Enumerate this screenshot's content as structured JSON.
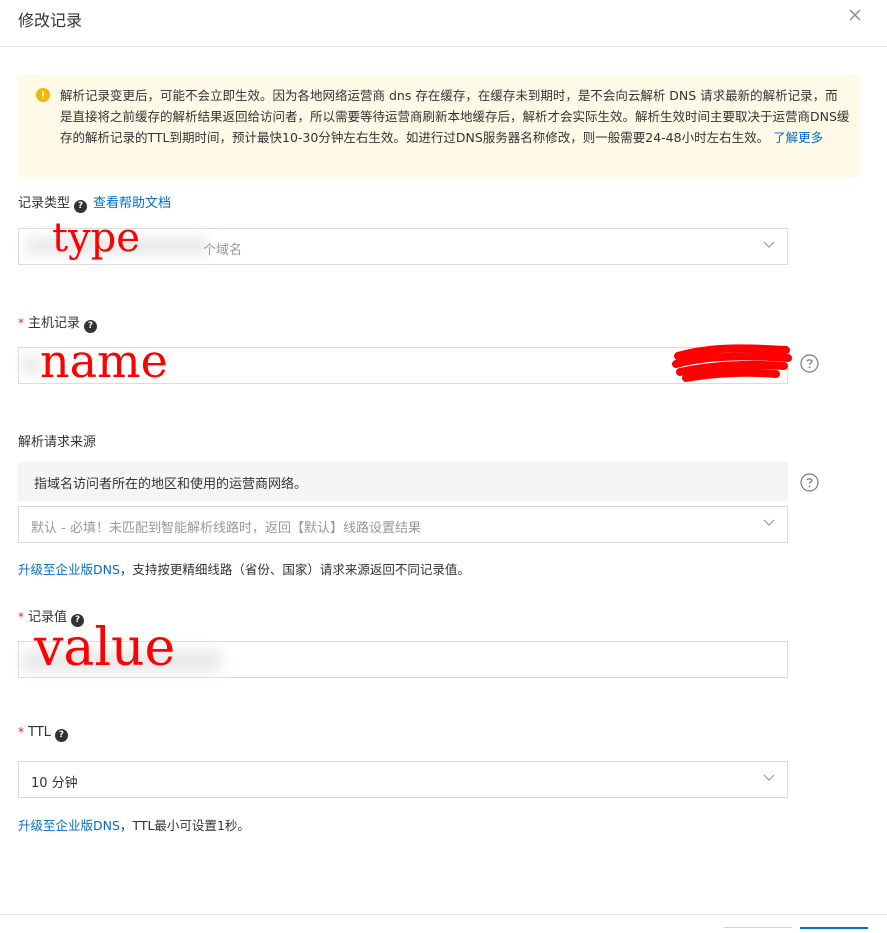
{
  "dialog": {
    "title": "修改记录",
    "close_icon": "close-icon"
  },
  "notice": {
    "icon": "warning-icon",
    "text": "解析记录变更后，可能不会立即生效。因为各地网络运营商 dns 存在缓存，在缓存未到期时，是不会向云解析 DNS 请求最新的解析记录，而是直接将之前缓存的解析结果返回给访问者，所以需要等待运营商刷新本地缓存后，解析才会实际生效。解析生效时间主要取决于运营商DNS缓存的解析记录的TTL到期时间，预计最快10-30分钟左右生效。如进行过DNS服务器名称修改，则一般需要24-48小时左右生效。",
    "link": "了解更多"
  },
  "record_type": {
    "label": "记录类型",
    "doc_link": "查看帮助文档",
    "value_suffix": "个域名",
    "annotation": "type"
  },
  "host": {
    "label": "主机记录",
    "annotation": "name"
  },
  "source": {
    "label": "解析请求来源",
    "hint": "指域名访问者所在的地区和使用的运营商网络。",
    "placeholder": "默认 - 必填！未匹配到智能解析线路时，返回【默认】线路设置结果",
    "promo_link": "升级至企业版DNS",
    "promo_text": "，支持按更精细线路（省份、国家）请求来源返回不同记录值。"
  },
  "record_value": {
    "label": "记录值",
    "annotation": "value"
  },
  "ttl": {
    "label": "TTL",
    "value": "10 分钟",
    "promo_link": "升级至企业版DNS",
    "promo_text": "，TTL最小可设置1秒。"
  },
  "colors": {
    "accent": "#0070cc",
    "required": "#d93026",
    "notice_bg": "#fff9e8",
    "annotation": "#ff0000"
  }
}
